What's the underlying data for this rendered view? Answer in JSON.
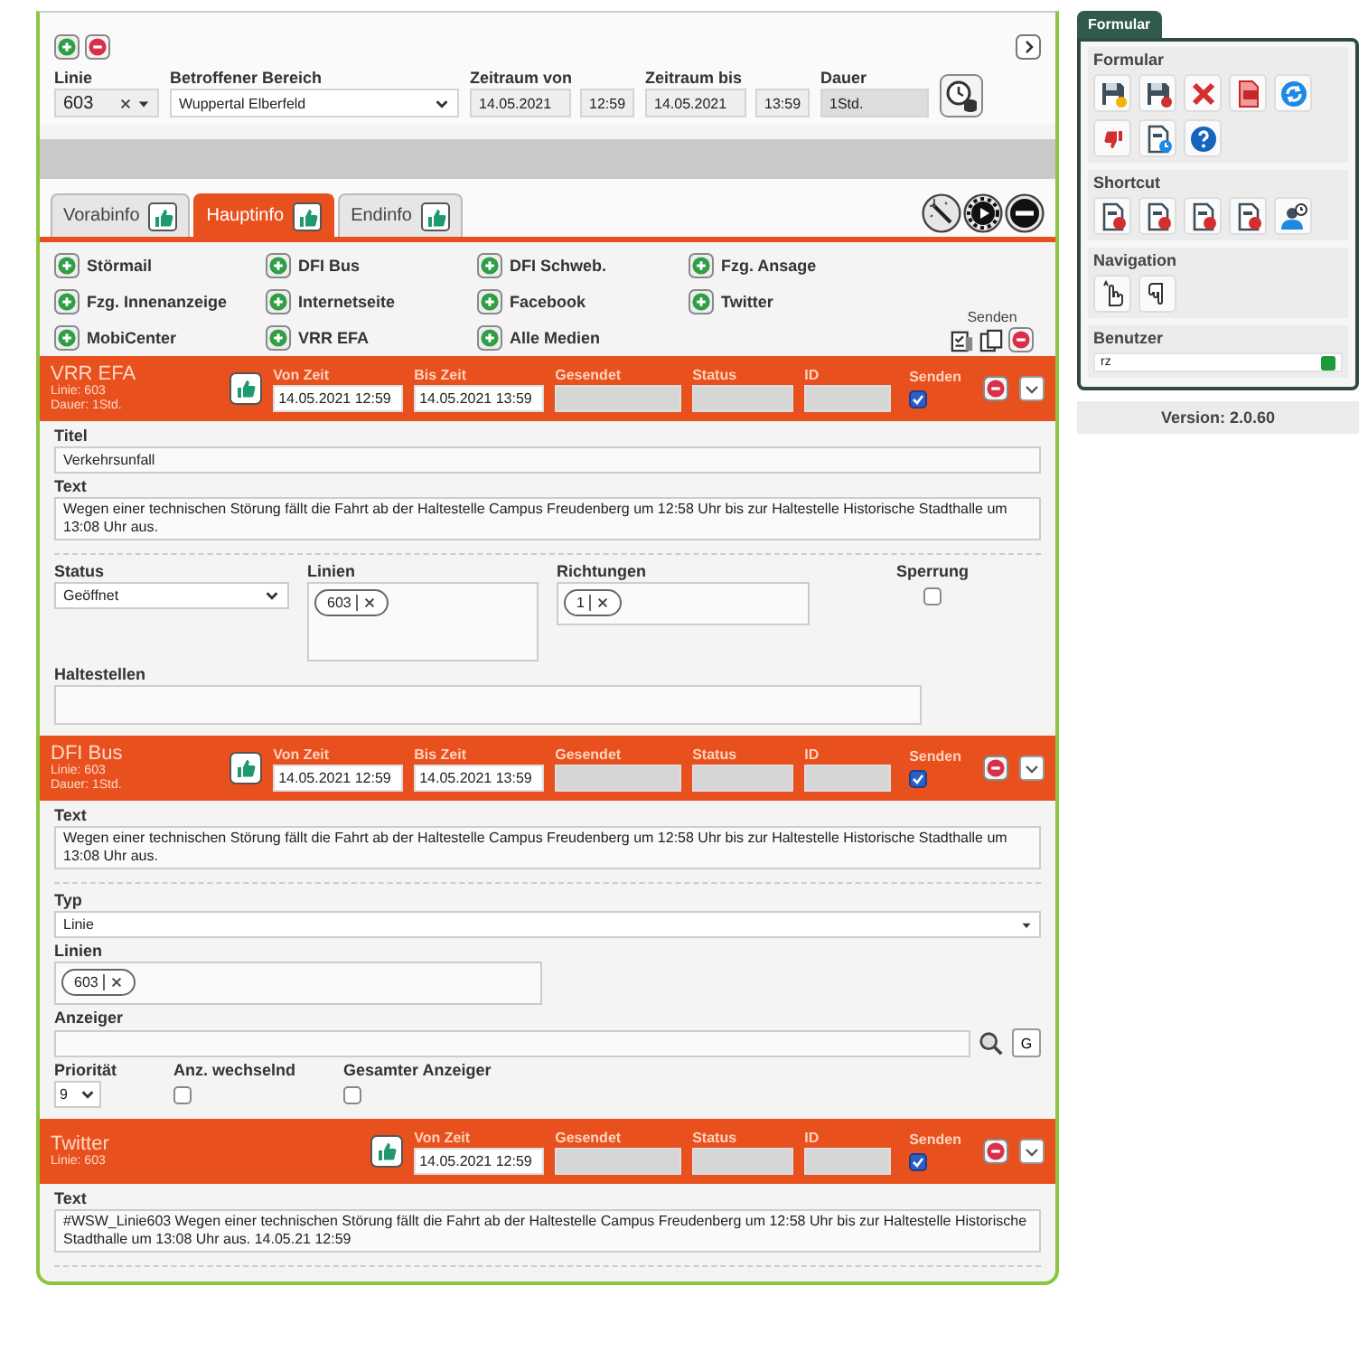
{
  "top": {
    "linie": {
      "label": "Linie",
      "value": "603"
    },
    "bereich": {
      "label": "Betroffener Bereich",
      "value": "Wuppertal Elberfeld"
    },
    "von": {
      "label": "Zeitraum von",
      "date": "14.05.2021",
      "time": "12:59"
    },
    "bis": {
      "label": "Zeitraum bis",
      "date": "14.05.2021",
      "time": "13:59"
    },
    "dauer": {
      "label": "Dauer",
      "value": "1Std."
    }
  },
  "tabs": [
    {
      "label": "Vorabinfo",
      "selected": false
    },
    {
      "label": "Hauptinfo",
      "selected": true
    },
    {
      "label": "Endinfo",
      "selected": false
    }
  ],
  "channels": [
    {
      "label": "Störmail"
    },
    {
      "label": "DFI Bus"
    },
    {
      "label": "DFI Schweb."
    },
    {
      "label": "Fzg. Ansage"
    },
    {
      "label": "Fzg. Innenanzeige"
    },
    {
      "label": "Internetseite"
    },
    {
      "label": "Facebook"
    },
    {
      "label": "Twitter"
    },
    {
      "label": "MobiCenter"
    },
    {
      "label": "VRR EFA"
    },
    {
      "label": "Alle Medien"
    }
  ],
  "send_all": {
    "label": "Senden"
  },
  "sections": [
    {
      "title": "VRR EFA",
      "info": [
        "Linie: 603",
        "Dauer: 1Std."
      ],
      "fields": [
        {
          "label": "Von Zeit",
          "kind": "time",
          "value": "14.05.2021 12:59"
        },
        {
          "label": "Bis Zeit",
          "kind": "time",
          "value": "14.05.2021 13:59"
        },
        {
          "label": "Gesendet",
          "kind": "readonly"
        },
        {
          "label": "Status",
          "kind": "readonly"
        },
        {
          "label": "ID",
          "kind": "readonly"
        }
      ],
      "send": {
        "label": "Senden",
        "checked": true
      },
      "rows": [
        [
          {
            "kind": "input",
            "label": "Titel",
            "value": "Verkehrsunfall"
          }
        ],
        [
          {
            "kind": "textarea",
            "label": "Text",
            "value": "Wegen einer technischen Störung fällt die Fahrt ab der Haltestelle Campus Freudenberg um 12:58 Uhr bis zur Haltestelle Historische Stadthalle um 13:08 Uhr aus."
          }
        ],
        [
          {
            "kind": "select",
            "label": "Status",
            "value": "Geöffnet"
          },
          {
            "kind": "tags",
            "label": "Linien",
            "tags": [
              "603"
            ]
          },
          {
            "kind": "tags",
            "label": "Richtungen",
            "tags": [
              "1"
            ]
          },
          {
            "kind": "checkbox",
            "label": "Sperrung",
            "checked": false
          }
        ],
        [
          {
            "kind": "input",
            "label": "Haltestellen"
          }
        ]
      ]
    },
    {
      "title": "DFI Bus",
      "info": [
        "Linie: 603",
        "Dauer: 1Std."
      ],
      "fields": [
        {
          "label": "Von Zeit",
          "kind": "time",
          "value": "14.05.2021 12:59"
        },
        {
          "label": "Bis Zeit",
          "kind": "time",
          "value": "14.05.2021 13:59"
        },
        {
          "label": "Gesendet",
          "kind": "readonly"
        },
        {
          "label": "Status",
          "kind": "readonly"
        },
        {
          "label": "ID",
          "kind": "readonly"
        }
      ],
      "send": {
        "label": "Senden",
        "checked": true
      },
      "rows": [
        [
          {
            "kind": "textarea",
            "label": "Text",
            "value": "Wegen einer technischen Störung fällt die Fahrt ab der Haltestelle Campus Freudenberg um 12:58 Uhr bis zur Haltestelle Historische Stadthalle um 13:08 Uhr aus."
          }
        ],
        [
          {
            "kind": "dropdown",
            "label": "Typ",
            "value": "Linie"
          }
        ],
        [
          {
            "kind": "tags",
            "label": "Linien",
            "tags": [
              "603"
            ]
          }
        ],
        [
          {
            "kind": "lookup",
            "label": "Anzeiger",
            "button": "G"
          }
        ],
        [
          {
            "kind": "select",
            "label": "Priorität",
            "value": "9"
          },
          {
            "kind": "checkbox",
            "label": "Anz. wechselnd",
            "checked": false
          },
          {
            "kind": "checkbox",
            "label": "Gesamter Anzeiger",
            "checked": false
          }
        ]
      ]
    },
    {
      "title": "Twitter",
      "info": [
        "Linie: 603"
      ],
      "fields": [
        {
          "label": "Von Zeit",
          "kind": "time",
          "value": "14.05.2021 12:59"
        },
        {
          "label": "Gesendet",
          "kind": "readonly"
        },
        {
          "label": "Status",
          "kind": "readonly"
        },
        {
          "label": "ID",
          "kind": "readonly"
        }
      ],
      "send": {
        "label": "Senden",
        "checked": true
      },
      "rows": [
        [
          {
            "kind": "textarea",
            "label": "Text",
            "value": "#WSW_Linie603 Wegen einer technischen Störung fällt die Fahrt ab der Haltestelle Campus Freudenberg um 12:58 Uhr bis zur Haltestelle Historische Stadthalle um 13:08 Uhr aus. 14.05.21 12:59"
          }
        ]
      ]
    }
  ],
  "sidebar": {
    "tab": "Formular",
    "groups": [
      {
        "title": "Formular"
      },
      {
        "title": "Shortcut"
      },
      {
        "title": "Navigation"
      }
    ],
    "user": {
      "label": "Benutzer",
      "value": "rz"
    },
    "version": "Version: 2.0.60"
  }
}
